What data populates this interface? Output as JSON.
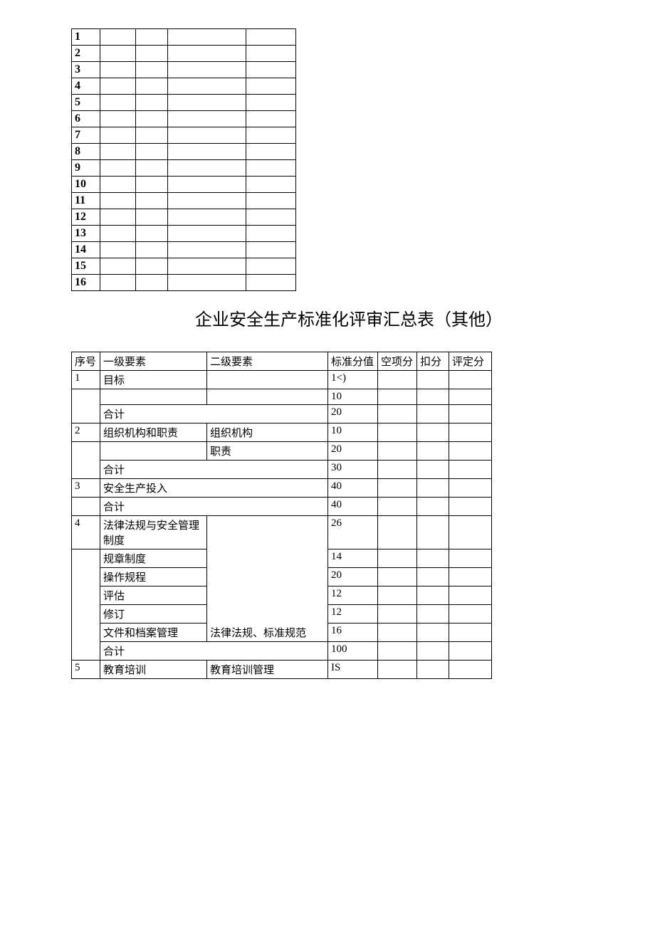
{
  "table1": {
    "rows": [
      "1",
      "2",
      "3",
      "4",
      "5",
      "6",
      "7",
      "8",
      "9",
      "10",
      "11",
      "12",
      "13",
      "14",
      "15",
      "16"
    ]
  },
  "title": "企业安全生产标准化评审汇总表（其他）",
  "table2": {
    "headers": {
      "seq": "序号",
      "level1": "一级要素",
      "level2": "二级要素",
      "stdScore": "标准分值",
      "emptyScore": "空项分",
      "deduct": "扣分",
      "finalScore": "评定分"
    },
    "rows": [
      {
        "seq": "1",
        "l1": "目标",
        "l2": "",
        "std": "1<)"
      },
      {
        "seq": "",
        "l1": "",
        "l2": "",
        "std": "10"
      },
      {
        "seq": "",
        "l1": "合计",
        "merged": true,
        "std": "20"
      },
      {
        "seq": "2",
        "l1": "组织机构和职责",
        "l2": "组织机构",
        "std": "10"
      },
      {
        "seq": "",
        "l1": "",
        "l2": "职责",
        "std": "20"
      },
      {
        "seq": "",
        "l1": "合计",
        "merged": true,
        "std": "30"
      },
      {
        "seq": "3",
        "l1": "安全生产投入",
        "merged": true,
        "std": "40"
      },
      {
        "seq": "",
        "l1": "合计",
        "merged": true,
        "std": "40"
      },
      {
        "seq": "4",
        "l1": "法律法规与安全管理制度",
        "l2": "法律法规、标准规范",
        "std": "26",
        "l2rowspan": 6
      },
      {
        "seq": "",
        "l1": "规章制度",
        "std": "14",
        "nob": true
      },
      {
        "seq": "",
        "l1": "操作规程",
        "std": "20",
        "nob": true
      },
      {
        "seq": "",
        "l1": "评估",
        "std": "12",
        "nob": true
      },
      {
        "seq": "",
        "l1": "修订",
        "std": "12",
        "nob": true
      },
      {
        "seq": "",
        "l1": "文件和档案管理",
        "std": "16",
        "nob": true
      },
      {
        "seq": "",
        "l1": "合计",
        "merged": true,
        "std": "100"
      },
      {
        "seq": "5",
        "l1": "教育培训",
        "l2": "教育培训管理",
        "std": "IS"
      }
    ]
  }
}
